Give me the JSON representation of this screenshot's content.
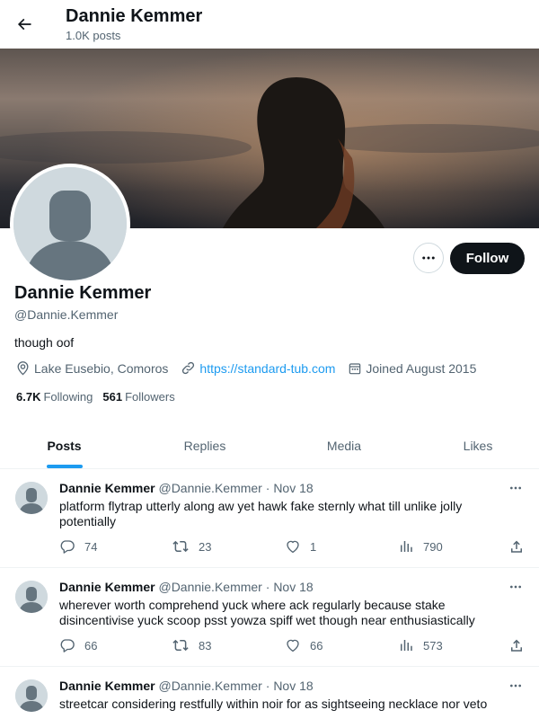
{
  "header": {
    "title": "Dannie Kemmer",
    "post_count": "1.0K posts"
  },
  "profile": {
    "name": "Dannie Kemmer",
    "handle": "@Dannie.Kemmer",
    "bio": "though oof",
    "location": "Lake Eusebio, Comoros",
    "website": "https://standard-tub.com",
    "joined": "Joined August 2015",
    "following_count": "6.7K",
    "following_label": "Following",
    "followers_count": "561",
    "followers_label": "Followers",
    "follow_label": "Follow"
  },
  "tabs": [
    {
      "label": "Posts",
      "active": true
    },
    {
      "label": "Replies",
      "active": false
    },
    {
      "label": "Media",
      "active": false
    },
    {
      "label": "Likes",
      "active": false
    }
  ],
  "posts": [
    {
      "name": "Dannie Kemmer",
      "handle": "@Dannie.Kemmer",
      "separator": "·",
      "date": "Nov 18",
      "text": "platform flytrap utterly along aw yet hawk fake sternly what till unlike jolly potentially",
      "replies": "74",
      "reposts": "23",
      "likes": "1",
      "views": "790"
    },
    {
      "name": "Dannie Kemmer",
      "handle": "@Dannie.Kemmer",
      "separator": "·",
      "date": "Nov 18",
      "text": "wherever worth comprehend yuck where ack regularly because stake disincentivise yuck scoop psst yowza spiff wet though near enthusiastically",
      "replies": "66",
      "reposts": "83",
      "likes": "66",
      "views": "573"
    },
    {
      "name": "Dannie Kemmer",
      "handle": "@Dannie.Kemmer",
      "separator": "·",
      "date": "Nov 18",
      "text": "streetcar considering restfully within noir for as sightseeing necklace nor veto",
      "replies": "",
      "reposts": "",
      "likes": "",
      "views": ""
    }
  ],
  "colors": {
    "accent": "#1d9bf0",
    "text": "#0f1419",
    "muted": "#536471",
    "border": "#eff3f4"
  }
}
